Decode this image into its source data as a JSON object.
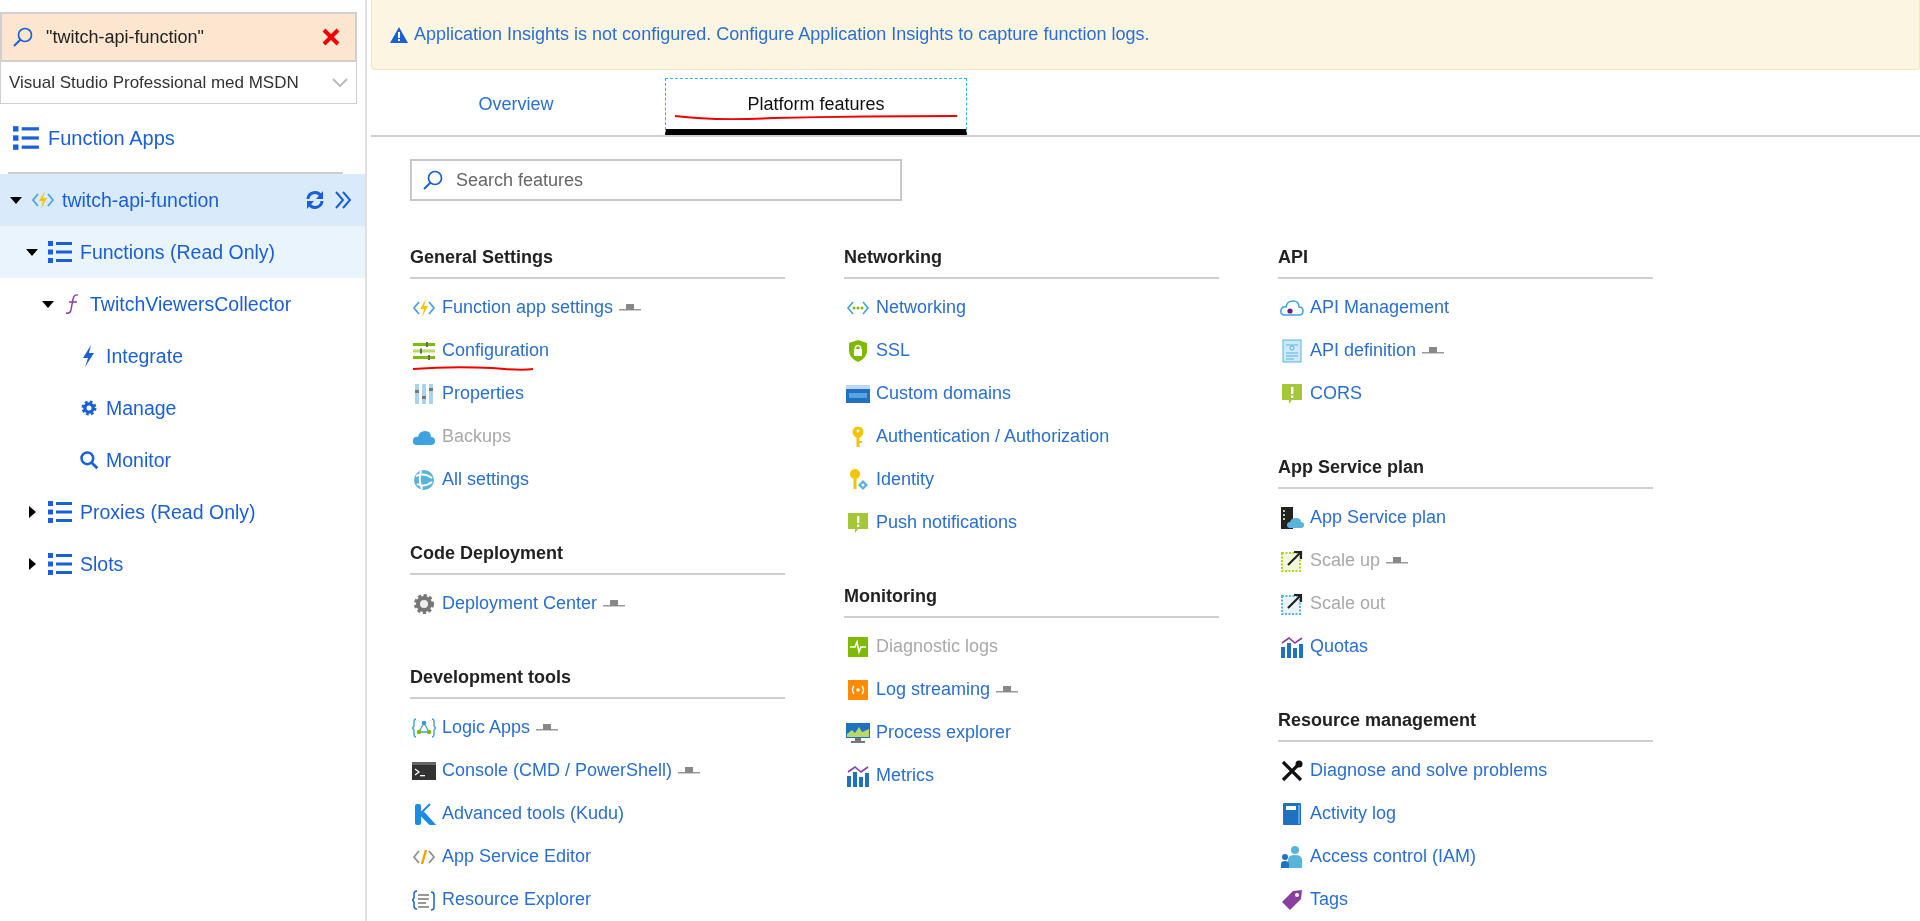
{
  "sidebar": {
    "search": {
      "value": "\"twitch-api-function\""
    },
    "subscription": {
      "value": "Visual Studio Professional med MSDN"
    },
    "heading": "Function Apps",
    "tree": [
      {
        "label": "twitch-api-function",
        "kind": "app",
        "selected": true,
        "hovered": false,
        "expanded": true,
        "children": [
          {
            "label": "Functions (Read Only)",
            "kind": "folder",
            "selected": false,
            "hovered": true,
            "expanded": true,
            "children": [
              {
                "label": "TwitchViewersCollector",
                "kind": "function",
                "selected": false,
                "hovered": false,
                "expanded": true,
                "children": [
                  {
                    "label": "Integrate",
                    "kind": "page",
                    "selected": false,
                    "hovered": false
                  },
                  {
                    "label": "Manage",
                    "kind": "page",
                    "selected": false,
                    "hovered": false
                  },
                  {
                    "label": "Monitor",
                    "kind": "page",
                    "selected": false,
                    "hovered": false
                  }
                ]
              }
            ]
          },
          {
            "label": "Proxies (Read Only)",
            "kind": "folder",
            "selected": false,
            "hovered": false,
            "expanded": false
          },
          {
            "label": "Slots",
            "kind": "folder",
            "selected": false,
            "hovered": false,
            "expanded": false
          }
        ]
      }
    ]
  },
  "banner": {
    "text": "Application Insights is not configured. Configure Application Insights to capture function logs."
  },
  "tabs": [
    {
      "label": "Overview",
      "selected": false,
      "underlined": false
    },
    {
      "label": "Platform features",
      "selected": true,
      "underlined": true
    }
  ],
  "search": {
    "placeholder": "Search features"
  },
  "columns": [
    {
      "sections": [
        {
          "title": "General Settings",
          "items": [
            {
              "label": "Function app settings",
              "disabled": false,
              "preview": true,
              "underlined": false
            },
            {
              "label": "Configuration",
              "disabled": false,
              "preview": false,
              "underlined": true
            },
            {
              "label": "Properties",
              "disabled": false,
              "preview": false,
              "underlined": false
            },
            {
              "label": "Backups",
              "disabled": true,
              "preview": false,
              "underlined": false
            },
            {
              "label": "All settings",
              "disabled": false,
              "preview": false,
              "underlined": false
            }
          ]
        },
        {
          "title": "Code Deployment",
          "items": [
            {
              "label": "Deployment Center",
              "disabled": false,
              "preview": true,
              "underlined": false
            }
          ]
        },
        {
          "title": "Development tools",
          "items": [
            {
              "label": "Logic Apps",
              "disabled": false,
              "preview": true,
              "underlined": false
            },
            {
              "label": "Console (CMD / PowerShell)",
              "disabled": false,
              "preview": true,
              "underlined": false
            },
            {
              "label": "Advanced tools (Kudu)",
              "disabled": false,
              "preview": false,
              "underlined": false
            },
            {
              "label": "App Service Editor",
              "disabled": false,
              "preview": false,
              "underlined": false
            },
            {
              "label": "Resource Explorer",
              "disabled": false,
              "preview": false,
              "underlined": false
            }
          ]
        }
      ]
    },
    {
      "sections": [
        {
          "title": "Networking",
          "items": [
            {
              "label": "Networking",
              "disabled": false,
              "preview": false,
              "underlined": false
            },
            {
              "label": "SSL",
              "disabled": false,
              "preview": false,
              "underlined": false
            },
            {
              "label": "Custom domains",
              "disabled": false,
              "preview": false,
              "underlined": false
            },
            {
              "label": "Authentication / Authorization",
              "disabled": false,
              "preview": false,
              "underlined": false
            },
            {
              "label": "Identity",
              "disabled": false,
              "preview": false,
              "underlined": false
            },
            {
              "label": "Push notifications",
              "disabled": false,
              "preview": false,
              "underlined": false
            }
          ]
        },
        {
          "title": "Monitoring",
          "items": [
            {
              "label": "Diagnostic logs",
              "disabled": true,
              "preview": false,
              "underlined": false
            },
            {
              "label": "Log streaming",
              "disabled": false,
              "preview": true,
              "underlined": false
            },
            {
              "label": "Process explorer",
              "disabled": false,
              "preview": false,
              "underlined": false
            },
            {
              "label": "Metrics",
              "disabled": false,
              "preview": false,
              "underlined": false
            }
          ]
        }
      ]
    },
    {
      "sections": [
        {
          "title": "API",
          "items": [
            {
              "label": "API Management",
              "disabled": false,
              "preview": false,
              "underlined": false
            },
            {
              "label": "API definition",
              "disabled": false,
              "preview": true,
              "underlined": false
            },
            {
              "label": "CORS",
              "disabled": false,
              "preview": false,
              "underlined": false
            }
          ]
        },
        {
          "title": "App Service plan",
          "items": [
            {
              "label": "App Service plan",
              "disabled": false,
              "preview": false,
              "underlined": false
            },
            {
              "label": "Scale up",
              "disabled": true,
              "preview": true,
              "underlined": false
            },
            {
              "label": "Scale out",
              "disabled": true,
              "preview": false,
              "underlined": false
            },
            {
              "label": "Quotas",
              "disabled": false,
              "preview": false,
              "underlined": false
            }
          ]
        },
        {
          "title": "Resource management",
          "items": [
            {
              "label": "Diagnose and solve problems",
              "disabled": false,
              "preview": false,
              "underlined": false
            },
            {
              "label": "Activity log",
              "disabled": false,
              "preview": false,
              "underlined": false
            },
            {
              "label": "Access control (IAM)",
              "disabled": false,
              "preview": false,
              "underlined": false
            },
            {
              "label": "Tags",
              "disabled": false,
              "preview": false,
              "underlined": false
            }
          ]
        }
      ]
    }
  ]
}
